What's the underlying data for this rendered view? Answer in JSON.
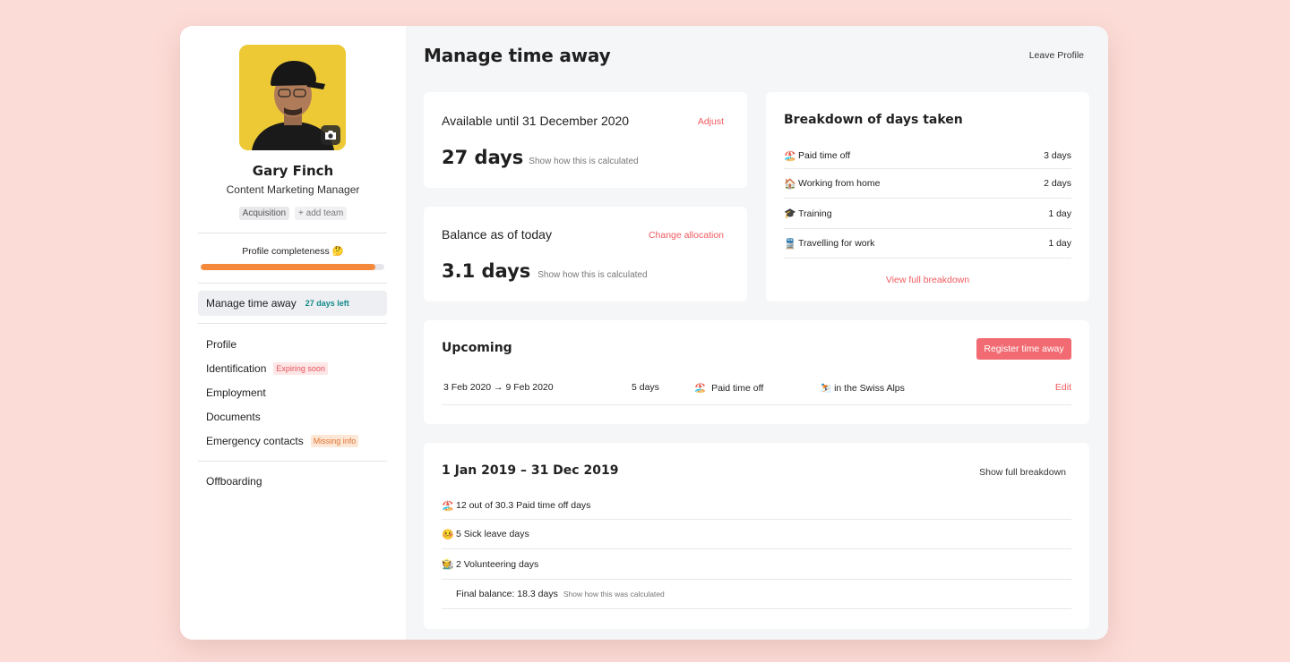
{
  "profile": {
    "name": "Gary Finch",
    "role": "Content Marketing Manager",
    "teams": [
      "Acquisition"
    ],
    "add_team_label": "+ add team",
    "completeness_label": "Profile completeness 🤔",
    "completeness_fraction": 0.95
  },
  "nav": {
    "active": {
      "label": "Manage time away",
      "badge": "27 days left"
    },
    "items": [
      {
        "label": "Profile",
        "badge": ""
      },
      {
        "label": "Identification",
        "badge": "Expiring soon"
      },
      {
        "label": "Employment",
        "badge": ""
      },
      {
        "label": "Documents",
        "badge": ""
      },
      {
        "label": "Emergency contacts",
        "badge": "Missing info"
      }
    ],
    "offboarding": "Offboarding"
  },
  "header": {
    "title": "Manage time away",
    "leave_link": "Leave Profile"
  },
  "available": {
    "title": "Available until 31 December 2020",
    "action": "Adjust",
    "value": "27 days",
    "hint": "Show how this is calculated"
  },
  "balance": {
    "title": "Balance as of today",
    "action": "Change allocation",
    "value": "3.1 days",
    "hint": "Show how this is calculated"
  },
  "breakdown": {
    "title": "Breakdown of days taken",
    "rows": [
      {
        "icon": "🏖️",
        "label": "Paid time off",
        "value": "3 days"
      },
      {
        "icon": "🏠",
        "label": "Working from home",
        "value": "2 days"
      },
      {
        "icon": "🎓",
        "label": "Training",
        "value": "1 day"
      },
      {
        "icon": "🚆",
        "label": "Travelling for work",
        "value": "1 day"
      }
    ],
    "link": "View full breakdown"
  },
  "upcoming": {
    "title": "Upcoming",
    "button": "Register time away",
    "entry": {
      "dates": "3 Feb 2020 → 9 Feb 2020",
      "duration": "5 days",
      "type_icon": "🏖️",
      "type": "Paid time off",
      "note_icon": "⛷️",
      "note": "in the Swiss Alps",
      "action": "Edit"
    }
  },
  "period": {
    "title": "1 Jan 2019 – 31 Dec 2019",
    "link": "Show full breakdown",
    "rows": [
      {
        "icon": "🏖️",
        "label": "12 out of 30.3 Paid time off days"
      },
      {
        "icon": "🤒",
        "label": "5 Sick leave days"
      },
      {
        "icon": "🧑‍🌾",
        "label": "2 Volunteering days"
      }
    ],
    "final": {
      "label": "Final balance: 18.3 days",
      "hint": "Show how this was calculated"
    }
  },
  "colors": {
    "accent": "#ef5a5f",
    "progress": "#f5893b",
    "teal": "#138a8a",
    "background": "#fcdcd7"
  }
}
